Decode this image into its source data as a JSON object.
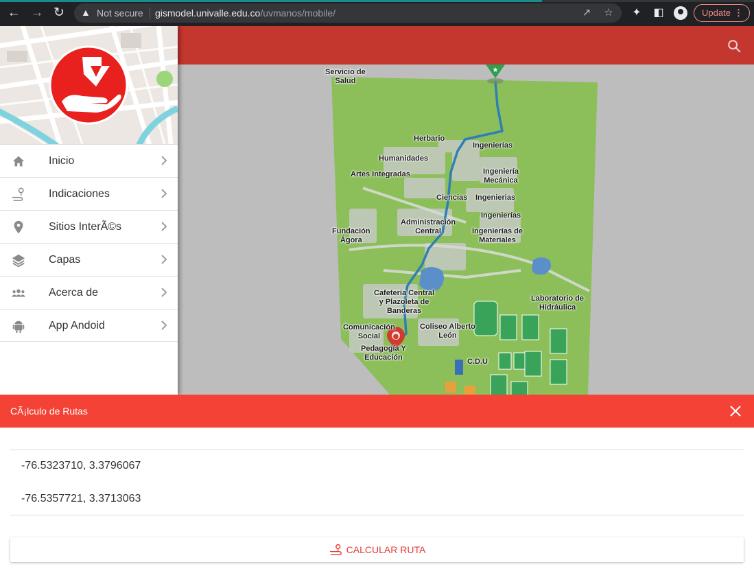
{
  "browser": {
    "security": "Not secure",
    "url_host": "gismodel.univalle.edu.co",
    "url_path": "/uvmanos/mobile/",
    "update_label": "Update",
    "theme_accent": "#1a8c8c"
  },
  "header": {
    "color": "#c4372e",
    "search_icon": "search-icon"
  },
  "sidebar": {
    "logo_icon": "hand-with-marker-logo",
    "items": [
      {
        "label": "Inicio",
        "icon": "home-icon"
      },
      {
        "label": "Indicaciones",
        "icon": "route-icon"
      },
      {
        "label": "Sitios InterÃ©s",
        "icon": "place-marker-icon"
      },
      {
        "label": "Capas",
        "icon": "layers-icon"
      },
      {
        "label": "Acerca de",
        "icon": "people-icon"
      },
      {
        "label": "App Andoid",
        "icon": "android-icon"
      }
    ]
  },
  "map": {
    "labels": [
      {
        "text": "Servicio de\nSalud"
      },
      {
        "text": "Herbario"
      },
      {
        "text": "Humanidades"
      },
      {
        "text": "Ingenierías"
      },
      {
        "text": "Artes Integradas"
      },
      {
        "text": "Ingeniería\nMecánica"
      },
      {
        "text": "Ciencias"
      },
      {
        "text": "Ingenierias"
      },
      {
        "text": "Ingenierías"
      },
      {
        "text": "Administración\nCentral"
      },
      {
        "text": "Fundación\nÁgora"
      },
      {
        "text": "Ingenierías de\nMateriales"
      },
      {
        "text": "Laboratorio de\nHidráulica"
      },
      {
        "text": "Cafetería Central\ny Plazoleta de\nBanderas"
      },
      {
        "text": "Comunicación\nSocial"
      },
      {
        "text": "Coliseo Alberto\nLeón"
      },
      {
        "text": "Pedagogía Y\nEducación"
      },
      {
        "text": "C.D.U"
      }
    ],
    "start_marker": "walker-marker-icon",
    "end_marker": "walker-marker-icon",
    "route_color": "#2f7fb5",
    "campus_color": "#8cbf5a"
  },
  "route_panel": {
    "title": "CÃ¡lculo de Rutas",
    "coords": [
      "-76.5323710, 3.3796067",
      "-76.5357721, 3.3713063"
    ],
    "button_label": "CALCULAR RUTA",
    "bar_color": "#f44336"
  }
}
